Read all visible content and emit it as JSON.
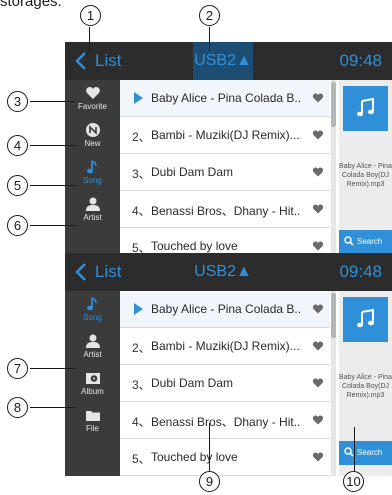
{
  "caption": "storages.",
  "screens": [
    {
      "header": {
        "title": "List",
        "device": "USB2▲",
        "clock": "09:48"
      },
      "sidebar": [
        {
          "label": "Favorite",
          "icon": "heart-icon",
          "active": false
        },
        {
          "label": "New",
          "icon": "new-badge-icon",
          "active": false
        },
        {
          "label": "Song",
          "icon": "music-note-icon",
          "active": true
        },
        {
          "label": "Artist",
          "icon": "artist-icon",
          "active": false
        }
      ],
      "rows": [
        {
          "num": "",
          "title": "Baby Alice - Pina Colada B...",
          "playing": true
        },
        {
          "num": "2、",
          "title": "Bambi - Muziki(DJ Remix)....",
          "playing": false
        },
        {
          "num": "3、",
          "title": "Dubi Dam Dam",
          "playing": false
        },
        {
          "num": "4、",
          "title": "Benassi Bros、Dhany - Hit...",
          "playing": false
        },
        {
          "num": "5、",
          "title": "Touched by love",
          "playing": false
        }
      ],
      "info": "Baby Alice - Pina Colada Boy(DJ Remix).mp3",
      "search_label": "Search"
    },
    {
      "header": {
        "title": "List",
        "device": "USB2▲",
        "clock": "09:48"
      },
      "sidebar": [
        {
          "label": "Song",
          "icon": "music-note-icon",
          "active": true
        },
        {
          "label": "Artist",
          "icon": "artist-icon",
          "active": false
        },
        {
          "label": "Album",
          "icon": "album-icon",
          "active": false
        },
        {
          "label": "File",
          "icon": "folder-icon",
          "active": false
        }
      ],
      "rows": [
        {
          "num": "",
          "title": "Baby Alice - Pina Colada B...",
          "playing": true
        },
        {
          "num": "2、",
          "title": "Bambi - Muziki(DJ Remix)....",
          "playing": false
        },
        {
          "num": "3、",
          "title": "Dubi Dam Dam",
          "playing": false
        },
        {
          "num": "4、",
          "title": "Benassi Bros、Dhany - Hit...",
          "playing": false
        },
        {
          "num": "5、",
          "title": "Touched by love",
          "playing": false
        }
      ],
      "info": "Baby Alice - Pina Colada Boy(DJ Remix).mp3",
      "search_label": "Search"
    }
  ],
  "callouts": [
    "1",
    "2",
    "3",
    "4",
    "5",
    "6",
    "7",
    "8",
    "9",
    "10"
  ],
  "colors": {
    "accent": "#2f8fd8",
    "header": "#2c2c2c",
    "sidebar": "#3b3b3b"
  }
}
